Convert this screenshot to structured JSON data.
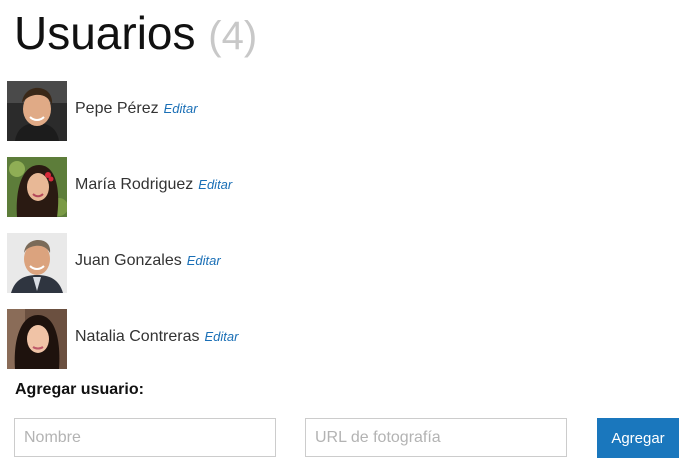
{
  "header": {
    "title": "Usuarios",
    "count": "(4)"
  },
  "users": [
    {
      "name": "Pepe Pérez",
      "edit_label": "Editar",
      "avatar": "man-photo-icon"
    },
    {
      "name": "María Rodriguez",
      "edit_label": "Editar",
      "avatar": "woman-photo-icon"
    },
    {
      "name": "Juan Gonzales",
      "edit_label": "Editar",
      "avatar": "man-photo-icon"
    },
    {
      "name": "Natalia Contreras",
      "edit_label": "Editar",
      "avatar": "woman-photo-icon"
    }
  ],
  "add_form": {
    "title": "Agregar usuario:",
    "name_placeholder": "Nombre",
    "name_value": "",
    "photo_placeholder": "URL de fotografía",
    "photo_value": "",
    "submit_label": "Agregar"
  },
  "colors": {
    "link": "#1a6fb6",
    "button": "#1a77bd",
    "muted_count": "#c8c8c8"
  }
}
